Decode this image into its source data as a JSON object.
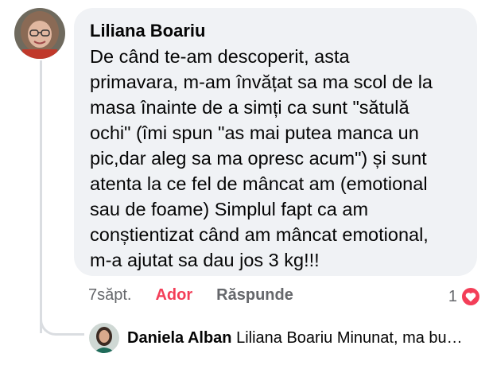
{
  "comment": {
    "author": "Liliana Boariu",
    "text": "De când te-am descoperit, asta\nprimavara, m-am învățat sa ma scol de la\nmasa înainte de a simți ca sunt \"sătulă\nochi\" (îmi spun \"as mai putea manca un\npic,dar aleg sa ma opresc acum\") și sunt\natenta la ce fel de mâncat am (emotional\nsau de foame) Simplul fapt ca am\nconștientizat când am mâncat emotional,\nm-a ajutat sa dau jos 3 kg!!!",
    "time": "7săpt.",
    "like_label": "Ador",
    "reply_label": "Răspunde",
    "reaction_count": "1",
    "reaction_icon": "heart-icon",
    "reaction_color": "#f33e58"
  },
  "reply": {
    "author": "Daniela Alban",
    "text": "Liliana Boariu Minunat, ma bu…"
  }
}
